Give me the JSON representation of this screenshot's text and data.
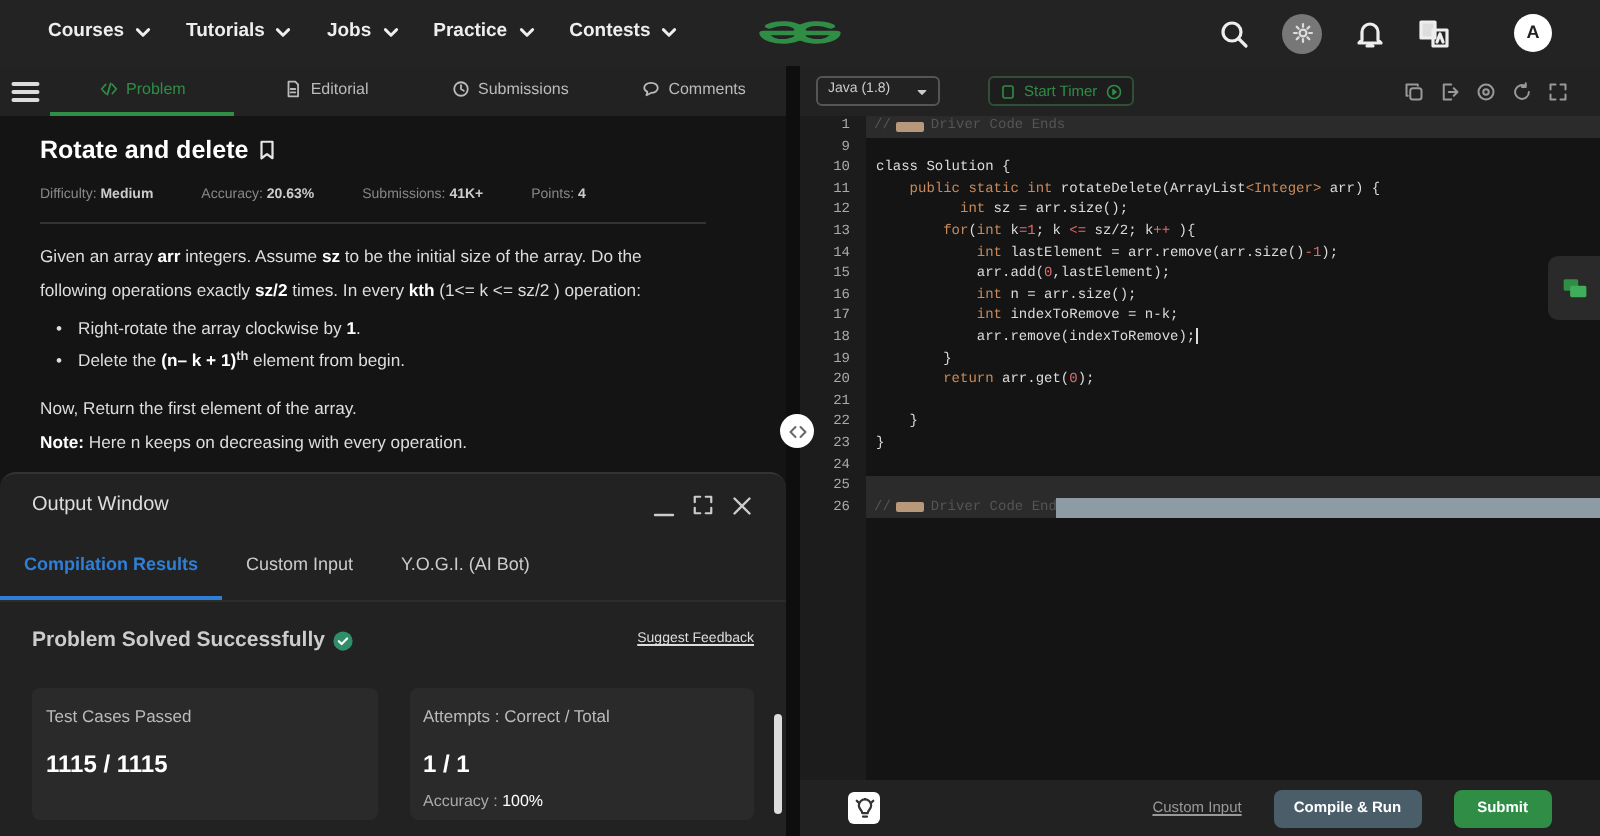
{
  "nav": {
    "menus": [
      {
        "label": "Courses"
      },
      {
        "label": "Tutorials"
      },
      {
        "label": "Jobs"
      },
      {
        "label": "Practice"
      },
      {
        "label": "Contests"
      }
    ],
    "avatar": "A"
  },
  "problem_tabs": [
    {
      "label": "Problem",
      "kind": "code",
      "selected": true
    },
    {
      "label": "Editorial",
      "kind": "doc",
      "selected": false
    },
    {
      "label": "Submissions",
      "kind": "clock",
      "selected": false
    },
    {
      "label": "Comments",
      "kind": "comment",
      "selected": false
    }
  ],
  "problem": {
    "title": "Rotate and delete",
    "meta": [
      "Difficulty: **Medium**",
      "Accuracy: **20.63%**",
      "Submissions: **41K+**",
      "Points: **4**"
    ],
    "statement": "Given an array **arr** integers. Assume **sz** to be the initial size of the array. Do the following operations exactly **sz/2** times. In every **kth** (1<= k <= sz/2 ) operation:",
    "bullets": [
      {
        "marker": "•",
        "text": "Right-rotate the array clockwise by **1**."
      },
      {
        "marker": "•",
        "text": "Delete the **(n– k + 1)**$^{th}$ element from begin."
      }
    ],
    "closing": [
      "Now, Return the first element of the array.",
      "**Note:** Here n keeps on decreasing with every operation."
    ]
  },
  "output_window": {
    "title": "Output Window",
    "tabs": [
      {
        "label": "Compilation Results",
        "selected": true
      },
      {
        "label": "Custom Input",
        "selected": false
      },
      {
        "label": "Y.O.G.I. (AI Bot)",
        "selected": false
      }
    ],
    "status": "Problem Solved Successfully",
    "feedback_link": "Suggest Feedback",
    "cards": [
      {
        "label": "Test Cases Passed",
        "value": "1115 / 1115"
      },
      {
        "label": "Attempts : Correct / Total",
        "value": "1 / 1",
        "note": "Accuracy : **100%**"
      }
    ]
  },
  "editor": {
    "language": "Java (1.8)",
    "timer_button": "Start Timer",
    "lines": [
      {
        "number": "1",
        "kind": "folded",
        "highlighted": true,
        "prefix": "//",
        "text": "Driver Code Ends"
      },
      {
        "number": "9",
        "kind": "code"
      },
      {
        "number": "10",
        "kind": "code",
        "tokens": [
          {
            "kind": "plain",
            "s": "class Solution {"
          }
        ]
      },
      {
        "number": "11",
        "kind": "code",
        "tokens": [
          {
            "kind": "kw",
            "s": "    public static int"
          },
          {
            "kind": "plain",
            "s": " rotateDelete(ArrayList"
          },
          {
            "kind": "kw",
            "s": "<Integer>"
          },
          {
            "kind": "plain",
            "s": " arr) {"
          }
        ]
      },
      {
        "number": "12",
        "kind": "code",
        "tokens": [
          {
            "kind": "kw",
            "s": "          int"
          },
          {
            "kind": "plain",
            "s": " sz = arr.size();"
          }
        ]
      },
      {
        "number": "13",
        "kind": "code",
        "tokens": [
          {
            "kind": "kw",
            "s": "        for"
          },
          {
            "kind": "plain",
            "s": "("
          },
          {
            "kind": "kw",
            "s": "int"
          },
          {
            "kind": "plain",
            "s": " k"
          },
          {
            "kind": "num",
            "s": "=1"
          },
          {
            "kind": "plain",
            "s": "; k "
          },
          {
            "kind": "num",
            "s": "<="
          },
          {
            "kind": "plain",
            "s": " sz/2; k"
          },
          {
            "kind": "num",
            "s": "++"
          },
          {
            "kind": "plain",
            "s": " ){"
          }
        ]
      },
      {
        "number": "14",
        "kind": "code",
        "tokens": [
          {
            "kind": "kw",
            "s": "            int"
          },
          {
            "kind": "plain",
            "s": " lastElement = arr.remove(arr.size()"
          },
          {
            "kind": "num",
            "s": "-1"
          },
          {
            "kind": "plain",
            "s": ");"
          }
        ]
      },
      {
        "number": "15",
        "kind": "code",
        "tokens": [
          {
            "kind": "plain",
            "s": "            arr.add("
          },
          {
            "kind": "num",
            "s": "0"
          },
          {
            "kind": "plain",
            "s": ",lastElement);"
          }
        ]
      },
      {
        "number": "16",
        "kind": "code",
        "tokens": [
          {
            "kind": "kw",
            "s": "            int"
          },
          {
            "kind": "plain",
            "s": " n = arr.size();"
          }
        ]
      },
      {
        "number": "17",
        "kind": "code",
        "tokens": [
          {
            "kind": "kw",
            "s": "            int"
          },
          {
            "kind": "plain",
            "s": " indexToRemove = n-k;"
          }
        ]
      },
      {
        "number": "18",
        "kind": "code",
        "cursor": true,
        "tokens": [
          {
            "kind": "plain",
            "s": "            arr.remove(indexToRemove);"
          }
        ]
      },
      {
        "number": "19",
        "kind": "code",
        "tokens": [
          {
            "kind": "plain",
            "s": "        }"
          }
        ]
      },
      {
        "number": "20",
        "kind": "code",
        "tokens": [
          {
            "kind": "kw",
            "s": "        return"
          },
          {
            "kind": "plain",
            "s": " arr.get("
          },
          {
            "kind": "num",
            "s": "0"
          },
          {
            "kind": "plain",
            "s": ");"
          }
        ]
      },
      {
        "number": "21",
        "kind": "code"
      },
      {
        "number": "22",
        "kind": "code",
        "tokens": [
          {
            "kind": "plain",
            "s": "    }"
          }
        ]
      },
      {
        "number": "23",
        "kind": "code",
        "tokens": [
          {
            "kind": "plain",
            "s": "}"
          }
        ]
      },
      {
        "number": "24",
        "kind": "code"
      },
      {
        "number": "25",
        "kind": "code",
        "highlighted": true
      },
      {
        "number": "26",
        "kind": "folded",
        "highlighted": true,
        "selection": true,
        "prefix": "//",
        "text": "Driver Code End"
      }
    ]
  },
  "footer": {
    "custom_input": "Custom Input",
    "buttons": [
      {
        "label": "Compile & Run",
        "kind": "secondary"
      },
      {
        "label": "Submit",
        "kind": "primary"
      }
    ]
  }
}
